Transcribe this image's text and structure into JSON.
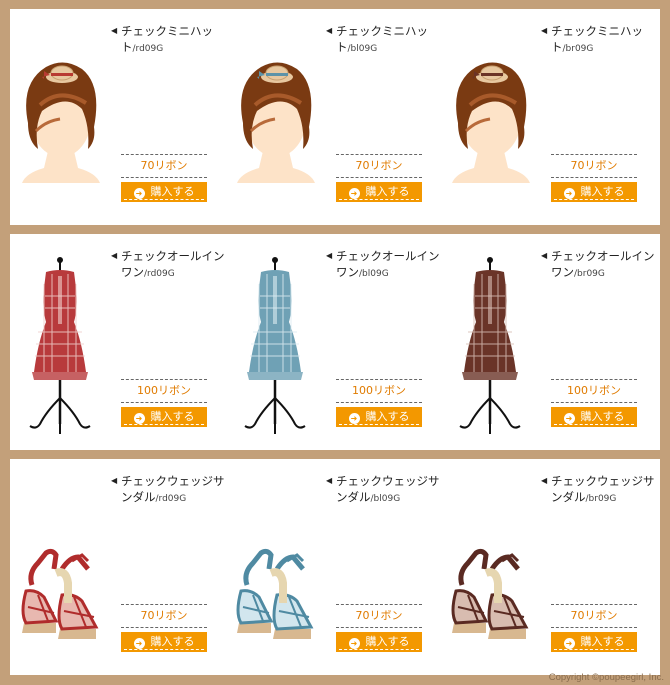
{
  "rows": [
    {
      "kind": "hat",
      "items": [
        {
          "name": "チェックミニハット",
          "code": "/rd09G",
          "price": "70リボン",
          "buy": "購入する",
          "color": "#b83a32",
          "color2": "#e8c8a0"
        },
        {
          "name": "チェックミニハット",
          "code": "/bl09G",
          "price": "70リボン",
          "buy": "購入する",
          "color": "#5d93a8",
          "color2": "#e8c8a0"
        },
        {
          "name": "チェックミニハット",
          "code": "/br09G",
          "price": "70リボン",
          "buy": "購入する",
          "color": "#6b3326",
          "color2": "#e8c8a0"
        }
      ]
    },
    {
      "kind": "dress",
      "items": [
        {
          "name": "チェックオールインワン",
          "code": "/rd09G",
          "price": "100リボン",
          "buy": "購入する",
          "color": "#b83a3c",
          "color2": "#f0d0cc"
        },
        {
          "name": "チェックオールインワン",
          "code": "/bl09G",
          "price": "100リボン",
          "buy": "購入する",
          "color": "#6fa1b5",
          "color2": "#dcecf2"
        },
        {
          "name": "チェックオールインワン",
          "code": "/br09G",
          "price": "100リボン",
          "buy": "購入する",
          "color": "#6a3428",
          "color2": "#d8beb4"
        }
      ]
    },
    {
      "kind": "sandal",
      "items": [
        {
          "name": "チェックウェッジサンダル",
          "code": "/rd09G",
          "price": "70リボン",
          "buy": "購入する",
          "color": "#b02c2c",
          "color2": "#e8b8b0"
        },
        {
          "name": "チェックウェッジサンダル",
          "code": "/bl09G",
          "price": "70リボン",
          "buy": "購入する",
          "color": "#4f8aa2",
          "color2": "#d2e6ee"
        },
        {
          "name": "チェックウェッジサンダル",
          "code": "/br09G",
          "price": "70リボン",
          "buy": "購入する",
          "color": "#5a2a22",
          "color2": "#d8bcb0"
        }
      ]
    }
  ],
  "copyright": "Copyright ©poupeegirl, Inc."
}
